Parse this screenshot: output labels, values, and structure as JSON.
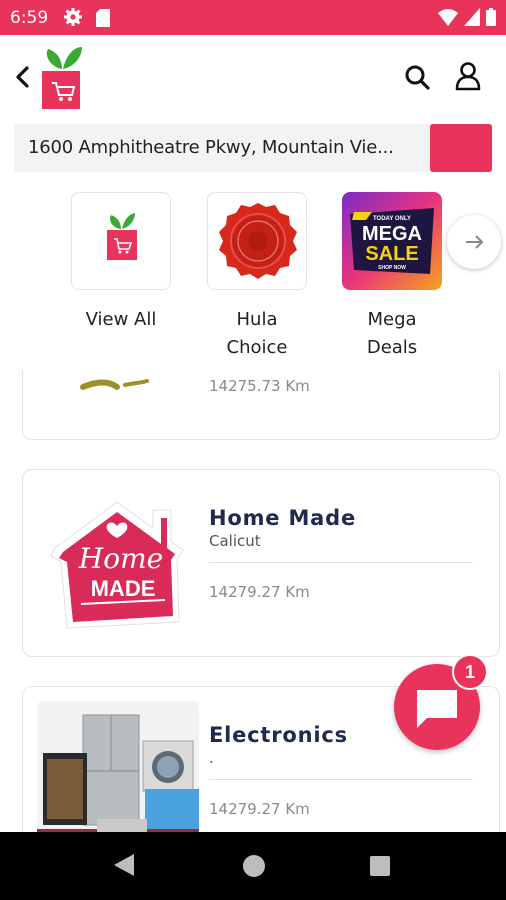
{
  "status_bar": {
    "time": "6:59",
    "icons": [
      "gear-icon",
      "sd-card-icon",
      "wifi-icon",
      "signal-icon",
      "battery-icon"
    ]
  },
  "header": {
    "icons": [
      "back-arrow-icon",
      "app-logo",
      "search-icon",
      "user-icon"
    ]
  },
  "address": {
    "text": "1600 Amphitheatre Pkwy, Mountain Vie..."
  },
  "categories": [
    {
      "label": "View All",
      "icon": "cart-logo-icon"
    },
    {
      "label": "Hula Choice",
      "icon": "seal-badge-icon"
    },
    {
      "label": "Mega Deals",
      "icon": "mega-sale-banner"
    }
  ],
  "mega_sale_banner": {
    "top": "TODAY ONLY",
    "line1": "MEGA",
    "line2": "SALE",
    "bottom": "SHOP NOW"
  },
  "stores": [
    {
      "name": "",
      "location": "",
      "distance": "14275.73 Km"
    },
    {
      "name": "Home Made",
      "location": "Calicut",
      "distance": "14279.27 Km",
      "logo_text": [
        "Home",
        "MADE"
      ]
    },
    {
      "name": "Electronics",
      "location": ".",
      "distance": "14279.27 Km"
    }
  ],
  "chat": {
    "badge_count": "1"
  },
  "colors": {
    "brand": "#e8345a",
    "title": "#1f2a4e",
    "green": "#3aa935"
  }
}
